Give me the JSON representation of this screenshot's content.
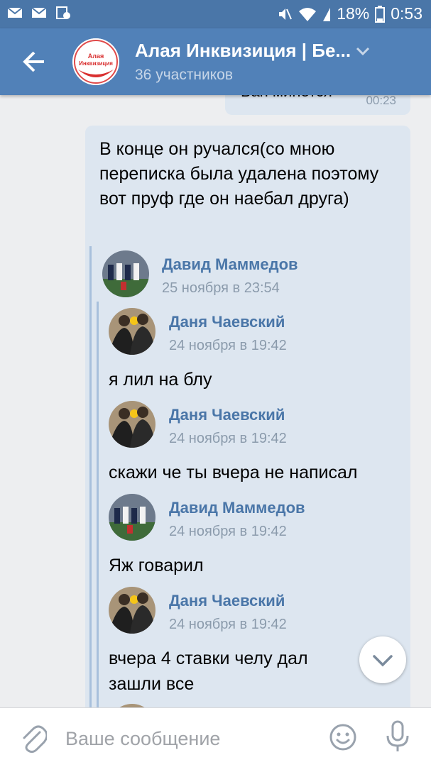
{
  "status_bar": {
    "battery": "18%",
    "time": "0:53"
  },
  "header": {
    "title": "Алая Инквизиция | Бе...",
    "subtitle": "36 участников",
    "avatar_text": "Алая Инквизиция"
  },
  "previous_message": {
    "text": "Бан минется",
    "time": "00:23"
  },
  "message": {
    "text": "В конце он ручался(со мною переписка была удалена поэтому вот пруф где он наебал друга)",
    "forwarded": {
      "author": "Давид Маммедов",
      "date": "25 ноября в 23:54",
      "items": [
        {
          "author": "Даня Чаевский",
          "date": "24 ноября в 19:42",
          "text": "я лил на блу"
        },
        {
          "author": "Даня Чаевский",
          "date": "24 ноября в 19:42",
          "text": "скажи че ты вчера не написал"
        },
        {
          "author": "Давид Маммедов",
          "date": "24 ноября в 19:42",
          "text": "Яж говарил"
        },
        {
          "author": "Даня Чаевский",
          "date": "24 ноября в 19:42",
          "text": "вчера 4 ставки челу дал зашли все"
        }
      ]
    }
  },
  "composer": {
    "placeholder": "Ваше сообщение"
  },
  "colors": {
    "header": "#5181b8",
    "status_bar": "#4a76a8",
    "bubble": "#dde6f0",
    "link": "#4a76a8"
  }
}
